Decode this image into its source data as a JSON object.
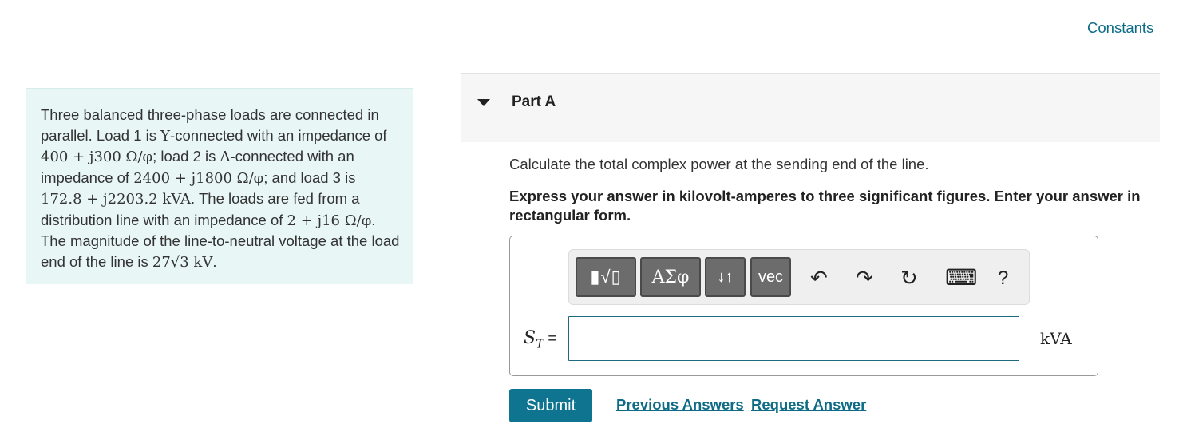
{
  "constants_link": "Constants",
  "problem": {
    "t1": "Three balanced three-phase loads are connected in parallel. Load 1 is ",
    "m1": "Y",
    "t2": "-connected with an impedance of ",
    "m2": "400 + j300 Ω/φ",
    "t3": "; load 2 is ",
    "m3": "Δ",
    "t4": "-connected with an impedance of ",
    "m4": "2400 + j1800 Ω/φ",
    "t5": "; and load 3 is ",
    "m5": "172.8 + j2203.2 kVA",
    "t6": ". The loads are fed from a distribution line with an impedance of ",
    "m6": "2 + j16 Ω/φ",
    "t7": ". The magnitude of the line-to-neutral voltage at the load end of the line is ",
    "m7": "27√3 kV",
    "t8": "."
  },
  "part": {
    "title": "Part A",
    "question": "Calculate the total complex power at the sending end of the line.",
    "instructions": "Express your answer in kilovolt-amperes to three significant figures. Enter your answer in rectangular form."
  },
  "toolbar": {
    "template_label": "▮√▯",
    "greek_label": "ΑΣφ",
    "arrows_label": "↓↑",
    "vec_label": "vec",
    "undo_icon": "↶",
    "redo_icon": "↷",
    "reset_icon": "↻",
    "keyboard_icon": "⌨",
    "help_label": "?"
  },
  "answer": {
    "variable": "S",
    "subscript": "T",
    "equals": " =",
    "value": "",
    "unit": "kVA"
  },
  "buttons": {
    "submit": "Submit",
    "previous_answers": "Previous Answers",
    "request_answer": "Request Answer"
  },
  "colors": {
    "accent": "#0e7490",
    "link": "#0d6b86",
    "panel_bg": "#e8f6f6"
  }
}
